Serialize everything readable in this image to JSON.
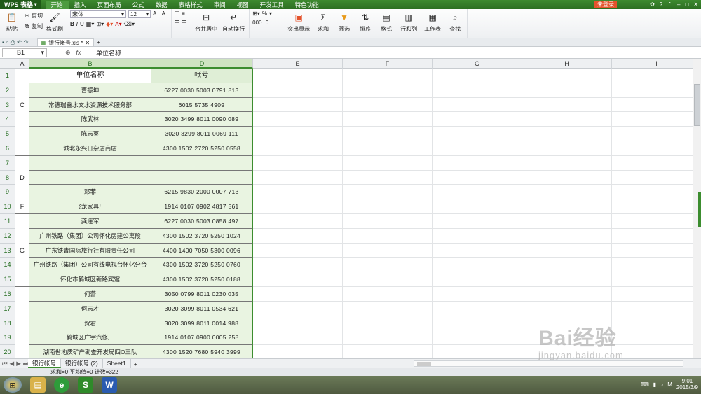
{
  "app": {
    "title": "WPS 表格",
    "login": "未登录"
  },
  "menus": [
    "开始",
    "插入",
    "页面布局",
    "公式",
    "数据",
    "表格样式",
    "审阅",
    "视图",
    "开发工具",
    "特色功能"
  ],
  "ribbon": {
    "paste": "粘贴",
    "cut": "剪切",
    "copy": "复制",
    "format_painter": "格式刷",
    "font_name": "宋体",
    "font_size": "12",
    "merge_center": "合并居中",
    "wrap_text": "自动换行",
    "highlight": "突出显示",
    "sum": "求和",
    "filter": "筛选",
    "sort": "排序",
    "format": "格式",
    "row_col": "行和列",
    "worksheet": "工作表",
    "find": "查找",
    "percent": "%"
  },
  "file_tab": {
    "name": "银行帐号.xls *"
  },
  "formula_bar": {
    "cell_ref": "B1",
    "value": "单位名称"
  },
  "columns": [
    "A",
    "B",
    "D",
    "E",
    "F",
    "G",
    "H",
    "I"
  ],
  "rows": [
    {
      "n": "1",
      "b": "单位名称",
      "d": "帐号"
    },
    {
      "n": "2",
      "b": "曹振坤",
      "d": "6227 0030 5003 0791 813"
    },
    {
      "n": "3",
      "b": "常德瑞鑫水文水资源技术服务部",
      "d": "6015 5735 4909"
    },
    {
      "n": "4",
      "b": "陈武林",
      "d": "3020 3499 8011 0090 089"
    },
    {
      "n": "5",
      "b": "陈志英",
      "d": "3020 3299 8011 0069 111"
    },
    {
      "n": "6",
      "b": "城北永兴日杂店商店",
      "d": "4300 1502 2720 5250 0558"
    },
    {
      "n": "7",
      "b": "",
      "d": ""
    },
    {
      "n": "8",
      "b": "",
      "d": ""
    },
    {
      "n": "9",
      "b": "邓菲",
      "d": "6215 9830 2000 0007 713"
    },
    {
      "n": "10",
      "b": "飞龙家具厂",
      "d": "1914 0107 0902 4817 561"
    },
    {
      "n": "11",
      "b": "龚连军",
      "d": "6227 0030 5003 0858 497"
    },
    {
      "n": "12",
      "b": "广州铁路（集团）公司怀化房建公寓段",
      "d": "4300 1502 3720 5250 1024"
    },
    {
      "n": "13",
      "b": "广东铁青国际旅行社有限责任公司",
      "d": "4400 1400 7050 5300 0096"
    },
    {
      "n": "14",
      "b": "广州铁路（集团）公司有线电视台怀化分台",
      "d": "4300 1502 3720 5250 0760"
    },
    {
      "n": "15",
      "b": "怀化市鹤城区新路宾馆",
      "d": "4300 1502 3720 5250 0188"
    },
    {
      "n": "16",
      "b": "何蕾",
      "d": "3050 0799 8011 0230 035"
    },
    {
      "n": "17",
      "b": "何志才",
      "d": "3020 3099 8011 0534 621"
    },
    {
      "n": "18",
      "b": "贺君",
      "d": "3020 3099 8011 0014 988"
    },
    {
      "n": "19",
      "b": "鹤城区广宇汽修厂",
      "d": "1914 0107 0900 0005 258"
    },
    {
      "n": "20",
      "b": "湖南省地质矿产勘查开发局四O三队",
      "d": "4300 1520 7680 5940 3999"
    }
  ],
  "group_labels": {
    "c": "C",
    "d": "D",
    "f": "F",
    "g": "G"
  },
  "sheets": [
    "银行帐号",
    "银行帐号 (2)",
    "Sheet1"
  ],
  "status": "求和=0  平均值=0  计数=322",
  "clock": {
    "time": "9:01",
    "date": "2015/3/9"
  },
  "watermark": {
    "brand": "Bai经验",
    "url": "jingyan.baidu.com"
  },
  "colors": {
    "accent": "#3c8d2f",
    "login": "#e4532c",
    "highlight_fill": "#e9f4e1"
  }
}
